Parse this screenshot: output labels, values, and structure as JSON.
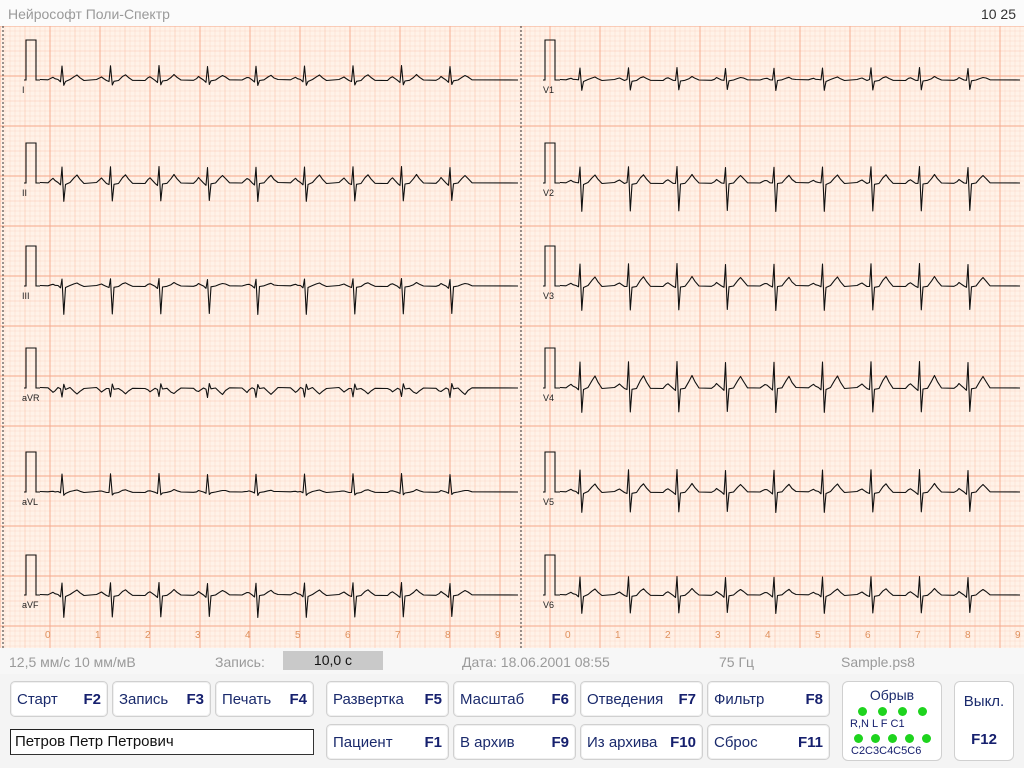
{
  "app": {
    "title": "Нейрософт Поли-Спектр",
    "clock": "10 25"
  },
  "ecg": {
    "left_leads": [
      "I",
      "II",
      "III",
      "aVR",
      "aVL",
      "aVF"
    ],
    "right_leads": [
      "V1",
      "V2",
      "V3",
      "V4",
      "V5",
      "V6"
    ],
    "time_axis": [
      "0",
      "1",
      "2",
      "3",
      "4",
      "5",
      "6",
      "7",
      "8",
      "9"
    ],
    "grid_color": "#f5a080",
    "background_color": "#fff2e8",
    "trace_color": "#111111"
  },
  "status": {
    "speed": "12,5 мм/с 10 мм/мВ",
    "record_label": "Запись:",
    "record_value": "10,0 с",
    "date": "Дата: 18.06.2001 08:55",
    "filter": "75 Гц",
    "file": "Sample.ps8"
  },
  "buttons": {
    "start": {
      "label": "Старт",
      "key": "F2"
    },
    "record": {
      "label": "Запись",
      "key": "F3"
    },
    "print": {
      "label": "Печать",
      "key": "F4"
    },
    "sweep": {
      "label": "Развертка",
      "key": "F5"
    },
    "scale": {
      "label": "Масштаб",
      "key": "F6"
    },
    "leads": {
      "label": "Отведения",
      "key": "F7"
    },
    "filter": {
      "label": "Фильтр",
      "key": "F8"
    },
    "patient": {
      "label": "Пациент",
      "key": "F1"
    },
    "to_archive": {
      "label": "В архив",
      "key": "F9"
    },
    "from_archive": {
      "label": "Из архива",
      "key": "F10"
    },
    "reset": {
      "label": "Сброс",
      "key": "F11"
    },
    "off": {
      "label": "Выкл.",
      "key": "F12"
    }
  },
  "patient_name": "Петров Петр Петрович",
  "electrodes": {
    "title": "Обрыв",
    "row1_label": "R,N  L   F  C1",
    "row2_label": "C2C3C4C5C6",
    "status_color": "#1ed41e"
  }
}
